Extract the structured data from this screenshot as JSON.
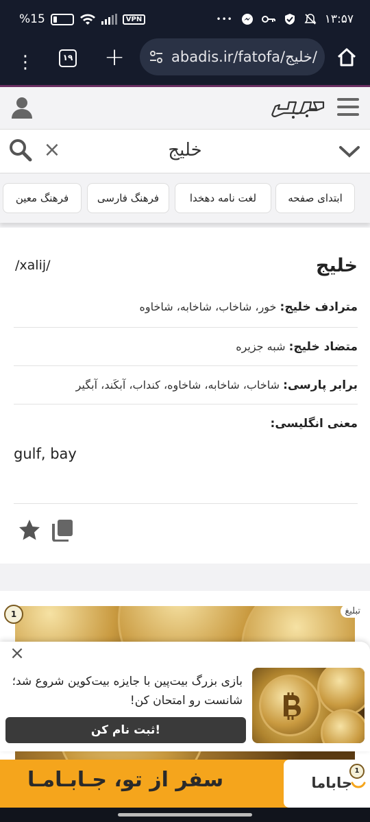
{
  "status": {
    "battery": "15",
    "battery_pct": "%",
    "vpn": "VPN",
    "time": "۱۳:۵۷",
    "dots": "•••"
  },
  "browser": {
    "tab_count": "۱۹",
    "url": "abadis.ir/fatofa/خلیج/"
  },
  "site": {
    "search_query": "خلیج"
  },
  "quick_links": [
    "ابتدای صفحه",
    "لغت نامه دهخدا",
    "فرهنگ فارسی",
    "فرهنگ معین"
  ],
  "entry": {
    "word": "خلیج",
    "pronunciation": "/xalij/",
    "synonyms_label": "مترادف خلیج:",
    "synonyms": "خور، شاخاب، شاخابه، شاخاوه",
    "antonyms_label": "متضاد خلیج:",
    "antonyms": "شبه جزیره",
    "persian_label": "برابر پارسی:",
    "persian": "شاخاب، شاخابه، شاخاوه، کنداب، آبکَند، آبگیر",
    "english_label": "معنی انگلیسی:",
    "english": "gulf, bay"
  },
  "ad": {
    "tag": "تبلیغ",
    "badge": "1"
  },
  "popup": {
    "message": "بازی بزرگ بیت‌پین با جایزه بیت‌کوین شروع شد؛ شانست رو امتحان کن!",
    "cta": "ثبت نام کن!"
  },
  "bottom_ad": {
    "slogan": "سفر از تو، جـابـامـا",
    "brand": "جاباما",
    "badge": "1"
  },
  "colors": {
    "statusbar": "#151b2b",
    "accent": "#6b2e62",
    "bottom_ad": "#f5a51c"
  }
}
